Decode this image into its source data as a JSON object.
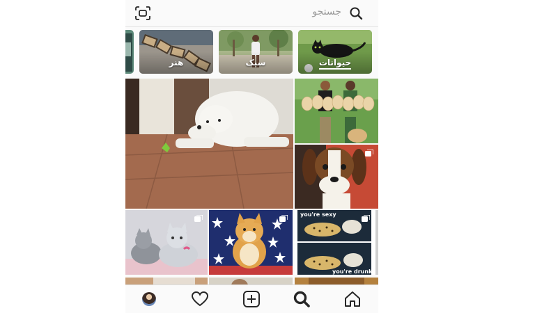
{
  "search": {
    "placeholder": "جستجو",
    "search_icon": "search-icon",
    "scan_icon": "scan-icon"
  },
  "categories": [
    {
      "label": "حیوانات",
      "selected": true
    },
    {
      "label": "سبک",
      "selected": false
    },
    {
      "label": "هنر",
      "selected": false
    },
    {
      "label": "",
      "selected": false
    }
  ],
  "grid": {
    "tiles": [
      {
        "subject": "white-dog-with-frog",
        "multi": false
      },
      {
        "subject": "family-holding-puppies",
        "multi": false
      },
      {
        "subject": "beagle-puppy",
        "multi": true
      },
      {
        "subject": "kittens",
        "multi": true
      },
      {
        "subject": "shiba-on-flag",
        "multi": true
      },
      {
        "subject": "cheetah-meme",
        "multi": true
      }
    ],
    "meme_text_top": "you're sexy",
    "meme_text_bottom": "you're drunk"
  },
  "bottom_nav": {
    "items": [
      "home-icon",
      "search-icon",
      "add-post-icon",
      "heart-icon",
      "profile-avatar"
    ],
    "active": "search-icon"
  },
  "colors": {
    "icon": "#262626",
    "background": "#fafafa",
    "border": "#dbdbdb"
  }
}
